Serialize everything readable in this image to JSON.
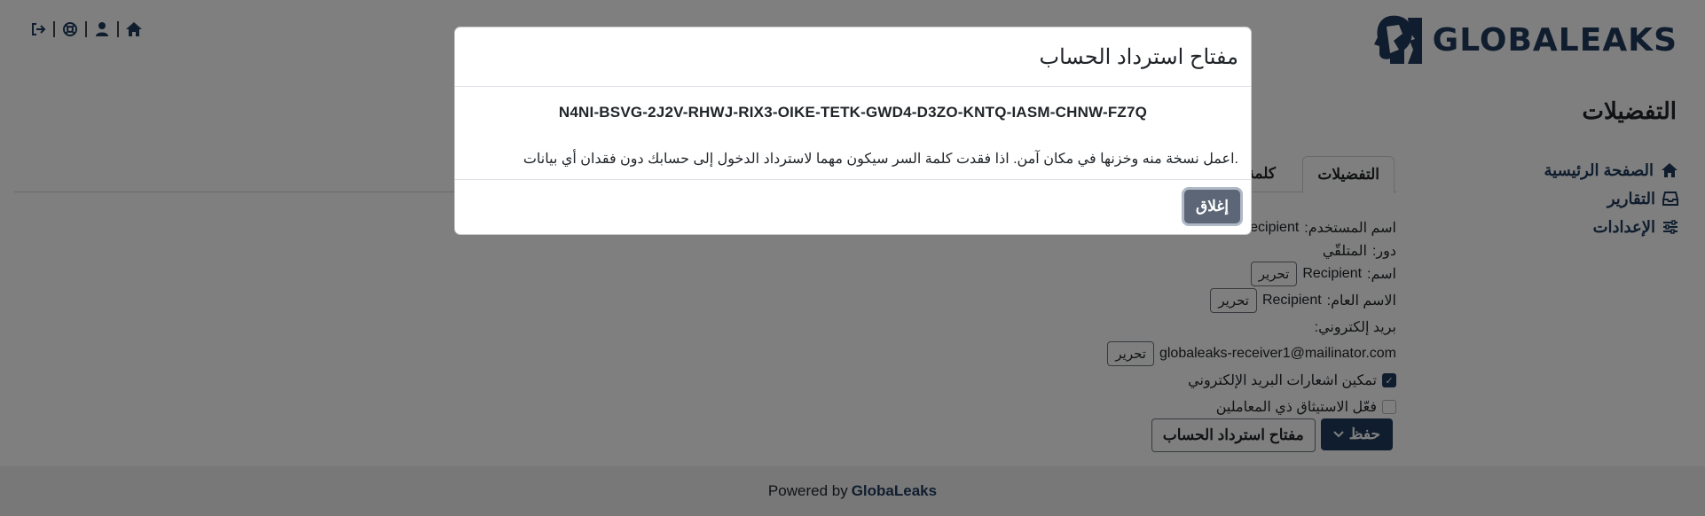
{
  "brand": {
    "name": "GLOBALEAKS",
    "color": "#1f3b5c"
  },
  "topnav": {
    "icons": [
      "logout-icon",
      "support-icon",
      "user-icon",
      "home-icon"
    ]
  },
  "page": {
    "title": "التفضيلات"
  },
  "sidebar": {
    "items": [
      {
        "label": "الصفحة الرئيسية",
        "icon": "home-icon"
      },
      {
        "label": "التقارير",
        "icon": "inbox-icon"
      },
      {
        "label": "الإعدادات",
        "icon": "sliders-icon"
      }
    ]
  },
  "tabs": [
    {
      "label": "التفضيلات",
      "active": true
    },
    {
      "label": "كلمة ا",
      "active": false
    }
  ],
  "profile": {
    "username_label": "اسم المستخدم:",
    "username_value": "Recipient",
    "role_label": "دور:",
    "role_value": "المتلقّي",
    "name_label": "اسم:",
    "name_value": "Recipient",
    "public_name_label": "الاسم العام:",
    "public_name_value": "Recipient",
    "email_label": "بريد إلكتروني:",
    "email_value": "globaleaks-receiver1@mailinator.com",
    "edit_label": "تحرير",
    "email_notifications_label": "تمكين اشعارات البريد الإلكتروني",
    "email_notifications_checked": true,
    "two_factor_label": "فعّل الاستيثاق ذي المعاملين",
    "two_factor_checked": false
  },
  "actions": {
    "save_label": "حفظ",
    "recovery_key_label": "مفتاح استرداد الحساب"
  },
  "footer": {
    "powered_by": "Powered by",
    "brand_link": "GlobaLeaks"
  },
  "modal": {
    "title": "مفتاح استرداد الحساب",
    "recovery_key": "N4NI-BSVG-2J2V-RHWJ-RIX3-OIKE-TETK-GWD4-D3ZO-KNTQ-IASM-CHNW-FZ7Q",
    "note": ".اعمل نسخة منه وخزنها في مكان آمن. اذا فقدت كلمة السر سيكون مهما لاسترداد الدخول إلى حسابك دون فقدان أي بيانات",
    "close_label": "إغلاق"
  }
}
